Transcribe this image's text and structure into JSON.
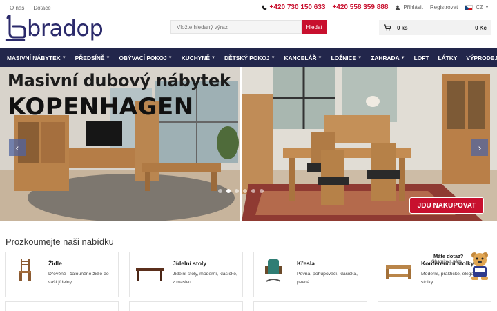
{
  "topbar": {
    "links": [
      "O nás",
      "Dotace"
    ],
    "phones": [
      "+420 730 150 633",
      "+420 558 359 888"
    ],
    "login": "Přihlásit",
    "register": "Registrovat",
    "lang": "CZ"
  },
  "logo": {
    "text": "bradop"
  },
  "search": {
    "placeholder": "Vložte hledaný výraz",
    "button": "Hledat"
  },
  "cart": {
    "count": "0 ks",
    "price": "0 Kč"
  },
  "nav": [
    {
      "label": "MASIVNÍ NÁBYTEK",
      "dropdown": true
    },
    {
      "label": "PŘEDSÍNĚ",
      "dropdown": true
    },
    {
      "label": "OBÝVACÍ POKOJ",
      "dropdown": true
    },
    {
      "label": "KUCHYNĚ",
      "dropdown": true
    },
    {
      "label": "DĚTSKÝ POKOJ",
      "dropdown": true
    },
    {
      "label": "KANCELÁŘ",
      "dropdown": true
    },
    {
      "label": "LOŽNICE",
      "dropdown": true
    },
    {
      "label": "ZAHRADA",
      "dropdown": true
    },
    {
      "label": "LOFT",
      "dropdown": false
    },
    {
      "label": "LÁTKY",
      "dropdown": false
    },
    {
      "label": "VÝPRODEJ",
      "dropdown": false
    }
  ],
  "hero": {
    "title1": "Masivní dubový nábytek",
    "title2": "KOPENHAGEN",
    "cta": "JDU NAKUPOVAT",
    "slides": 6,
    "active_slide": 1
  },
  "section": {
    "title": "Prozkoumejte naši nabídku"
  },
  "categories": [
    {
      "name": "Židle",
      "desc": "Dřevěné i čalouněné židle do vaší jídelny",
      "icon": "chair-icon"
    },
    {
      "name": "Jídelní stoly",
      "desc": "Jídelní stoly, moderní, klasické, z masivu...",
      "icon": "dining-table-icon"
    },
    {
      "name": "Křesla",
      "desc": "Pevná, pohupovací, klasická, pevná...",
      "icon": "armchair-icon"
    },
    {
      "name": "Konferenční stolky",
      "desc": "Moderní, praktické, elegantní stolky...",
      "icon": "coffee-table-icon"
    }
  ],
  "chat": {
    "question": "Máte dotaz?",
    "sub": "Chatujte s námi"
  },
  "colors": {
    "brand": "#2b2a6b",
    "accent": "#c8102e",
    "nav_bg": "#22264b"
  }
}
